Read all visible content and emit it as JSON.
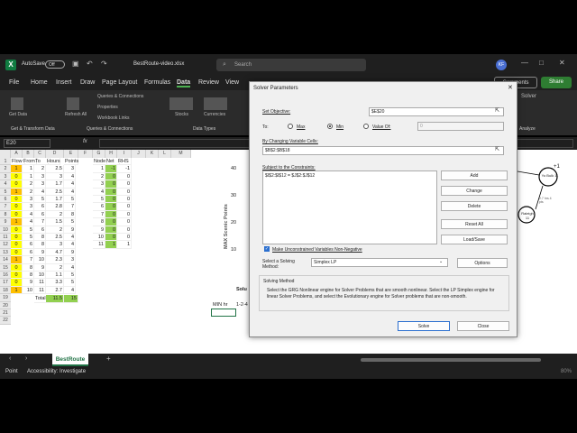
{
  "titlebar": {
    "autosave": "AutoSave",
    "toggle": "Off",
    "filename": "BestRoute-video.xlsx",
    "search": "Search",
    "avatar": "KF"
  },
  "menu": [
    "File",
    "Home",
    "Insert",
    "Draw",
    "Page Layout",
    "Formulas",
    "Data",
    "Review",
    "View",
    "Automate",
    "Help"
  ],
  "menu_right": {
    "comments": "Comments",
    "share": "Share"
  },
  "ribbon": {
    "get_data": "Get Data",
    "refresh": "Refresh All",
    "queries": "Queries & Connections",
    "properties": "Properties",
    "workbook_links": "Workbook Links",
    "stocks": "Stocks",
    "currencies": "Currencies",
    "solver": "Solver",
    "analyze": "Analyze",
    "groups": {
      "get": "Get & Transform Data",
      "qc": "Queries & Connections",
      "types": "Data Types"
    }
  },
  "formula": {
    "namebox": "E20",
    "fx": "fx"
  },
  "grid": {
    "cols": [
      "A",
      "B",
      "C",
      "D",
      "E",
      "F",
      "G",
      "H",
      "I",
      "J",
      "K",
      "L",
      "M"
    ],
    "headers": {
      "flow": "Flow",
      "from": "From",
      "to": "To",
      "hours": "Hours",
      "points": "Points",
      "node": "Node",
      "netflow": "Net Flow",
      "rhs": "RHS"
    },
    "rows": [
      [
        "1",
        "1",
        "2",
        "2.5",
        "3"
      ],
      [
        "0",
        "1",
        "3",
        "3",
        "4"
      ],
      [
        "0",
        "2",
        "3",
        "1.7",
        "4"
      ],
      [
        "1",
        "2",
        "4",
        "2.5",
        "4"
      ],
      [
        "0",
        "3",
        "5",
        "1.7",
        "5"
      ],
      [
        "0",
        "3",
        "6",
        "2.8",
        "7"
      ],
      [
        "0",
        "4",
        "6",
        "2",
        "8"
      ],
      [
        "1",
        "4",
        "7",
        "1.5",
        "5"
      ],
      [
        "0",
        "5",
        "6",
        "2",
        "9"
      ],
      [
        "0",
        "5",
        "8",
        "2.5",
        "4"
      ],
      [
        "0",
        "6",
        "8",
        "3",
        "4"
      ],
      [
        "0",
        "6",
        "9",
        "4.7",
        "9"
      ],
      [
        "1",
        "7",
        "10",
        "2.3",
        "3"
      ],
      [
        "0",
        "8",
        "9",
        "2",
        "4"
      ],
      [
        "0",
        "8",
        "10",
        "1.1",
        "5"
      ],
      [
        "0",
        "9",
        "11",
        "3.3",
        "5"
      ],
      [
        "1",
        "10",
        "11",
        "2.7",
        "4"
      ]
    ],
    "nodes": [
      [
        "1",
        "-1",
        "-1"
      ],
      [
        "2",
        "0",
        "0"
      ],
      [
        "3",
        "0",
        "0"
      ],
      [
        "4",
        "0",
        "0"
      ],
      [
        "5",
        "0",
        "0"
      ],
      [
        "6",
        "0",
        "0"
      ],
      [
        "7",
        "0",
        "0"
      ],
      [
        "8",
        "0",
        "0"
      ],
      [
        "9",
        "0",
        "0"
      ],
      [
        "10",
        "0",
        "0"
      ],
      [
        "11",
        "1",
        "1"
      ]
    ],
    "total_label": "Total",
    "total_hours": "11.5",
    "total_points": "15",
    "chart_ylabel": "MAX Scenic Points",
    "chart_ticks": [
      "40",
      "30",
      "20",
      "10"
    ],
    "solution_label": "Solu",
    "min_label": "MIN hr",
    "path_label": "1-2-4"
  },
  "network": {
    "node_a": "Yo Bulk 11",
    "node_b": "Raleigh 11",
    "e1": "2.7 hrs 4 pts",
    "plus": "+1"
  },
  "sheettab": "BestRoute",
  "status": {
    "ready": "Point",
    "accessibility": "Accessibility: Investigate",
    "zoom": "80%"
  },
  "dialog": {
    "title": "Solver Parameters",
    "set_objective": "Set Objective:",
    "objective": "$E$20",
    "to": "To:",
    "max": "Max",
    "min": "Min",
    "value_of": "Value Of:",
    "value": "0",
    "by_changing": "By Changing Variable Cells:",
    "variable_cells": "$B$2:$B$18",
    "subject_to": "Subject to the Constraints:",
    "constraint": "$I$2:$I$12 = $J$2:$J$12",
    "add": "Add",
    "change": "Change",
    "delete": "Delete",
    "reset": "Reset All",
    "loadsave": "Load/Save",
    "nonneg": "Make Unconstrained Variables Non-Negative",
    "select_method": "Select a Solving Method:",
    "method": "Simplex LP",
    "options": "Options",
    "solving_method": "Solving Method",
    "method_desc": "Select the GRG Nonlinear engine for Solver Problems that are smooth nonlinear. Select the LP Simplex engine for linear Solver Problems, and select the Evolutionary engine for Solver problems that are non-smooth.",
    "solve": "Solve",
    "close": "Close"
  }
}
